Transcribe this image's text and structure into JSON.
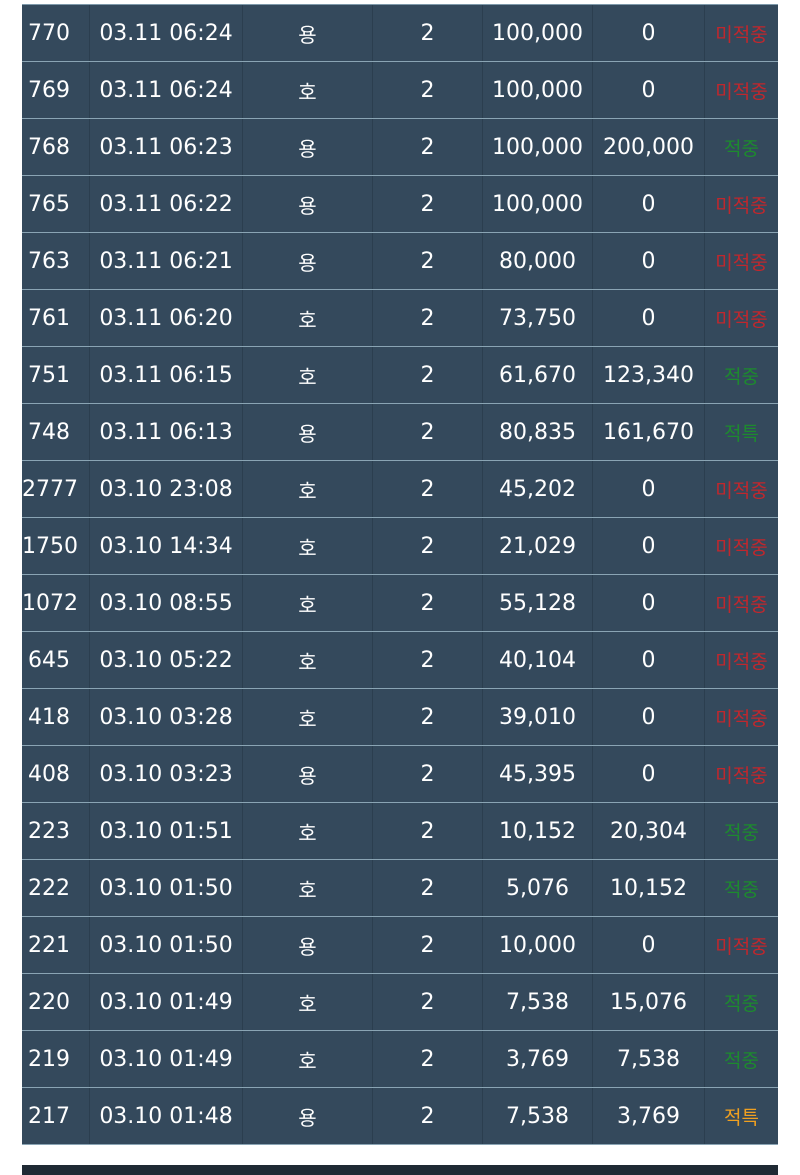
{
  "rows": [
    {
      "round": "770",
      "time": "03.11 06:24",
      "pick": "용",
      "count": "2",
      "bet": "100,000",
      "win": "0",
      "result": "미적중",
      "status": "miss"
    },
    {
      "round": "769",
      "time": "03.11 06:24",
      "pick": "호",
      "count": "2",
      "bet": "100,000",
      "win": "0",
      "result": "미적중",
      "status": "miss"
    },
    {
      "round": "768",
      "time": "03.11 06:23",
      "pick": "용",
      "count": "2",
      "bet": "100,000",
      "win": "200,000",
      "result": "적중",
      "status": "hit"
    },
    {
      "round": "765",
      "time": "03.11 06:22",
      "pick": "용",
      "count": "2",
      "bet": "100,000",
      "win": "0",
      "result": "미적중",
      "status": "miss"
    },
    {
      "round": "763",
      "time": "03.11 06:21",
      "pick": "용",
      "count": "2",
      "bet": "80,000",
      "win": "0",
      "result": "미적중",
      "status": "miss"
    },
    {
      "round": "761",
      "time": "03.11 06:20",
      "pick": "호",
      "count": "2",
      "bet": "73,750",
      "win": "0",
      "result": "미적중",
      "status": "miss"
    },
    {
      "round": "751",
      "time": "03.11 06:15",
      "pick": "호",
      "count": "2",
      "bet": "61,670",
      "win": "123,340",
      "result": "적중",
      "status": "hit"
    },
    {
      "round": "748",
      "time": "03.11 06:13",
      "pick": "용",
      "count": "2",
      "bet": "80,835",
      "win": "161,670",
      "result": "적특",
      "status": "hit"
    },
    {
      "round": "2777",
      "time": "03.10 23:08",
      "pick": "호",
      "count": "2",
      "bet": "45,202",
      "win": "0",
      "result": "미적중",
      "status": "miss"
    },
    {
      "round": "1750",
      "time": "03.10 14:34",
      "pick": "호",
      "count": "2",
      "bet": "21,029",
      "win": "0",
      "result": "미적중",
      "status": "miss"
    },
    {
      "round": "1072",
      "time": "03.10 08:55",
      "pick": "호",
      "count": "2",
      "bet": "55,128",
      "win": "0",
      "result": "미적중",
      "status": "miss"
    },
    {
      "round": "645",
      "time": "03.10 05:22",
      "pick": "호",
      "count": "2",
      "bet": "40,104",
      "win": "0",
      "result": "미적중",
      "status": "miss"
    },
    {
      "round": "418",
      "time": "03.10 03:28",
      "pick": "호",
      "count": "2",
      "bet": "39,010",
      "win": "0",
      "result": "미적중",
      "status": "miss"
    },
    {
      "round": "408",
      "time": "03.10 03:23",
      "pick": "용",
      "count": "2",
      "bet": "45,395",
      "win": "0",
      "result": "미적중",
      "status": "miss"
    },
    {
      "round": "223",
      "time": "03.10 01:51",
      "pick": "호",
      "count": "2",
      "bet": "10,152",
      "win": "20,304",
      "result": "적중",
      "status": "hit"
    },
    {
      "round": "222",
      "time": "03.10 01:50",
      "pick": "호",
      "count": "2",
      "bet": "5,076",
      "win": "10,152",
      "result": "적중",
      "status": "hit"
    },
    {
      "round": "221",
      "time": "03.10 01:50",
      "pick": "용",
      "count": "2",
      "bet": "10,000",
      "win": "0",
      "result": "미적중",
      "status": "miss"
    },
    {
      "round": "220",
      "time": "03.10 01:49",
      "pick": "호",
      "count": "2",
      "bet": "7,538",
      "win": "15,076",
      "result": "적중",
      "status": "hit"
    },
    {
      "round": "219",
      "time": "03.10 01:49",
      "pick": "호",
      "count": "2",
      "bet": "3,769",
      "win": "7,538",
      "result": "적중",
      "status": "hit"
    },
    {
      "round": "217",
      "time": "03.10 01:48",
      "pick": "용",
      "count": "2",
      "bet": "7,538",
      "win": "3,769",
      "result": "적특",
      "status": "special"
    }
  ],
  "colors": {
    "row_bg": "#34495c",
    "miss": "#c0272d",
    "hit": "#1d8a2e",
    "special": "#f0a020"
  }
}
